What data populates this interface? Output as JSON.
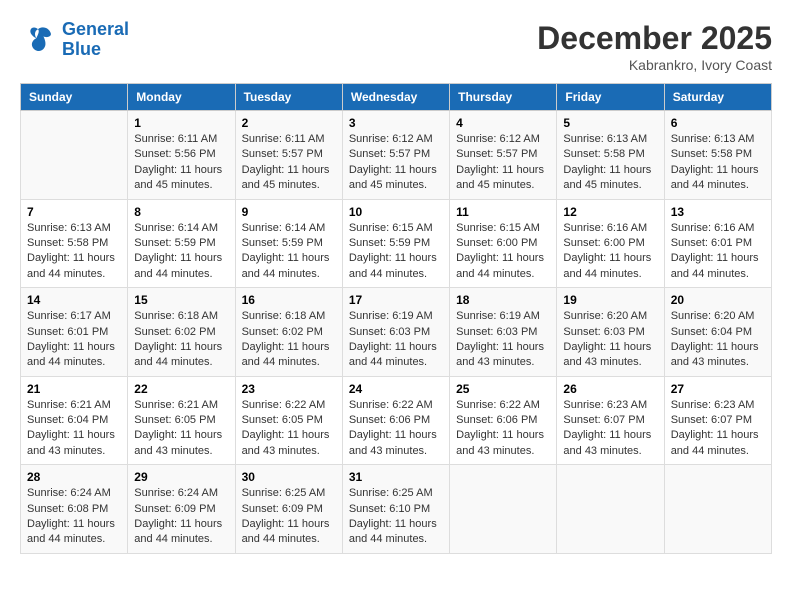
{
  "header": {
    "logo_line1": "General",
    "logo_line2": "Blue",
    "title": "December 2025",
    "subtitle": "Kabrankro, Ivory Coast"
  },
  "days_of_week": [
    "Sunday",
    "Monday",
    "Tuesday",
    "Wednesday",
    "Thursday",
    "Friday",
    "Saturday"
  ],
  "weeks": [
    [
      {
        "day": "",
        "info": ""
      },
      {
        "day": "1",
        "info": "Sunrise: 6:11 AM\nSunset: 5:56 PM\nDaylight: 11 hours and 45 minutes."
      },
      {
        "day": "2",
        "info": "Sunrise: 6:11 AM\nSunset: 5:57 PM\nDaylight: 11 hours and 45 minutes."
      },
      {
        "day": "3",
        "info": "Sunrise: 6:12 AM\nSunset: 5:57 PM\nDaylight: 11 hours and 45 minutes."
      },
      {
        "day": "4",
        "info": "Sunrise: 6:12 AM\nSunset: 5:57 PM\nDaylight: 11 hours and 45 minutes."
      },
      {
        "day": "5",
        "info": "Sunrise: 6:13 AM\nSunset: 5:58 PM\nDaylight: 11 hours and 45 minutes."
      },
      {
        "day": "6",
        "info": "Sunrise: 6:13 AM\nSunset: 5:58 PM\nDaylight: 11 hours and 44 minutes."
      }
    ],
    [
      {
        "day": "7",
        "info": "Sunrise: 6:13 AM\nSunset: 5:58 PM\nDaylight: 11 hours and 44 minutes."
      },
      {
        "day": "8",
        "info": "Sunrise: 6:14 AM\nSunset: 5:59 PM\nDaylight: 11 hours and 44 minutes."
      },
      {
        "day": "9",
        "info": "Sunrise: 6:14 AM\nSunset: 5:59 PM\nDaylight: 11 hours and 44 minutes."
      },
      {
        "day": "10",
        "info": "Sunrise: 6:15 AM\nSunset: 5:59 PM\nDaylight: 11 hours and 44 minutes."
      },
      {
        "day": "11",
        "info": "Sunrise: 6:15 AM\nSunset: 6:00 PM\nDaylight: 11 hours and 44 minutes."
      },
      {
        "day": "12",
        "info": "Sunrise: 6:16 AM\nSunset: 6:00 PM\nDaylight: 11 hours and 44 minutes."
      },
      {
        "day": "13",
        "info": "Sunrise: 6:16 AM\nSunset: 6:01 PM\nDaylight: 11 hours and 44 minutes."
      }
    ],
    [
      {
        "day": "14",
        "info": "Sunrise: 6:17 AM\nSunset: 6:01 PM\nDaylight: 11 hours and 44 minutes."
      },
      {
        "day": "15",
        "info": "Sunrise: 6:18 AM\nSunset: 6:02 PM\nDaylight: 11 hours and 44 minutes."
      },
      {
        "day": "16",
        "info": "Sunrise: 6:18 AM\nSunset: 6:02 PM\nDaylight: 11 hours and 44 minutes."
      },
      {
        "day": "17",
        "info": "Sunrise: 6:19 AM\nSunset: 6:03 PM\nDaylight: 11 hours and 44 minutes."
      },
      {
        "day": "18",
        "info": "Sunrise: 6:19 AM\nSunset: 6:03 PM\nDaylight: 11 hours and 43 minutes."
      },
      {
        "day": "19",
        "info": "Sunrise: 6:20 AM\nSunset: 6:03 PM\nDaylight: 11 hours and 43 minutes."
      },
      {
        "day": "20",
        "info": "Sunrise: 6:20 AM\nSunset: 6:04 PM\nDaylight: 11 hours and 43 minutes."
      }
    ],
    [
      {
        "day": "21",
        "info": "Sunrise: 6:21 AM\nSunset: 6:04 PM\nDaylight: 11 hours and 43 minutes."
      },
      {
        "day": "22",
        "info": "Sunrise: 6:21 AM\nSunset: 6:05 PM\nDaylight: 11 hours and 43 minutes."
      },
      {
        "day": "23",
        "info": "Sunrise: 6:22 AM\nSunset: 6:05 PM\nDaylight: 11 hours and 43 minutes."
      },
      {
        "day": "24",
        "info": "Sunrise: 6:22 AM\nSunset: 6:06 PM\nDaylight: 11 hours and 43 minutes."
      },
      {
        "day": "25",
        "info": "Sunrise: 6:22 AM\nSunset: 6:06 PM\nDaylight: 11 hours and 43 minutes."
      },
      {
        "day": "26",
        "info": "Sunrise: 6:23 AM\nSunset: 6:07 PM\nDaylight: 11 hours and 43 minutes."
      },
      {
        "day": "27",
        "info": "Sunrise: 6:23 AM\nSunset: 6:07 PM\nDaylight: 11 hours and 44 minutes."
      }
    ],
    [
      {
        "day": "28",
        "info": "Sunrise: 6:24 AM\nSunset: 6:08 PM\nDaylight: 11 hours and 44 minutes."
      },
      {
        "day": "29",
        "info": "Sunrise: 6:24 AM\nSunset: 6:09 PM\nDaylight: 11 hours and 44 minutes."
      },
      {
        "day": "30",
        "info": "Sunrise: 6:25 AM\nSunset: 6:09 PM\nDaylight: 11 hours and 44 minutes."
      },
      {
        "day": "31",
        "info": "Sunrise: 6:25 AM\nSunset: 6:10 PM\nDaylight: 11 hours and 44 minutes."
      },
      {
        "day": "",
        "info": ""
      },
      {
        "day": "",
        "info": ""
      },
      {
        "day": "",
        "info": ""
      }
    ]
  ]
}
